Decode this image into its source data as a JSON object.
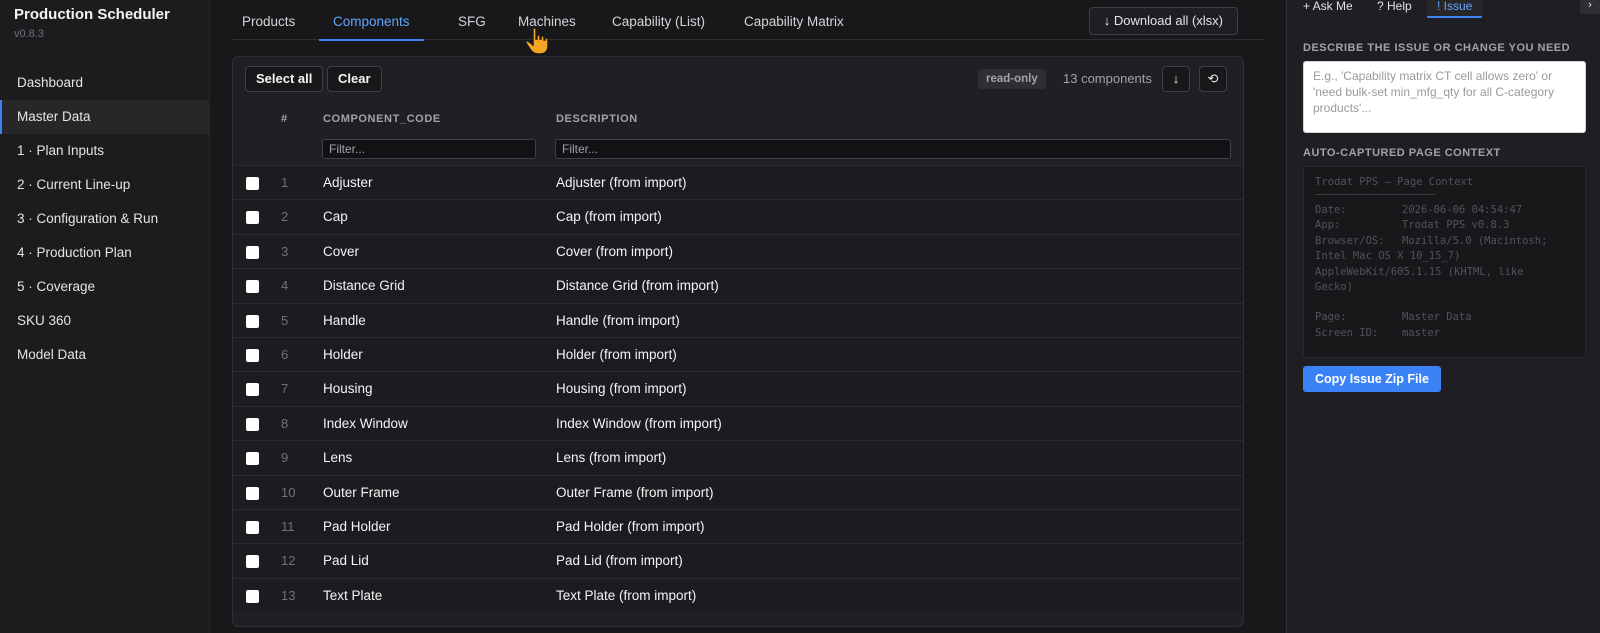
{
  "app": {
    "title": "Production Scheduler",
    "version": "v0.8.3"
  },
  "sidebar": {
    "items": [
      {
        "label": "Dashboard"
      },
      {
        "label": "Master Data"
      },
      {
        "label": "1 · Plan Inputs"
      },
      {
        "label": "2 · Current Line-up"
      },
      {
        "label": "3 · Configuration & Run"
      },
      {
        "label": "4 · Production Plan"
      },
      {
        "label": "5 · Coverage"
      },
      {
        "label": "SKU 360"
      },
      {
        "label": "Model Data"
      }
    ],
    "active_index": 1
  },
  "tabs": [
    {
      "label": "Products"
    },
    {
      "label": "Components"
    },
    {
      "label": "SFG"
    },
    {
      "label": "Machines"
    },
    {
      "label": "Capability (List)"
    },
    {
      "label": "Capability Matrix"
    }
  ],
  "active_tab": "Components",
  "download_label": "↓ Download all (xlsx)",
  "toolbar": {
    "select_all": "Select all",
    "clear": "Clear",
    "readonly": "read-only",
    "count": "13 components",
    "download_icon": "↓",
    "refresh_icon": "⟲"
  },
  "table": {
    "headers": {
      "num": "#",
      "code": "COMPONENT_CODE",
      "desc": "DESCRIPTION"
    },
    "filter_placeholder": "Filter...",
    "rows": [
      {
        "num": "1",
        "code": "Adjuster",
        "desc": "Adjuster (from import)"
      },
      {
        "num": "2",
        "code": "Cap",
        "desc": "Cap (from import)"
      },
      {
        "num": "3",
        "code": "Cover",
        "desc": "Cover (from import)"
      },
      {
        "num": "4",
        "code": "Distance Grid",
        "desc": "Distance Grid (from import)"
      },
      {
        "num": "5",
        "code": "Handle",
        "desc": "Handle (from import)"
      },
      {
        "num": "6",
        "code": "Holder",
        "desc": "Holder (from import)"
      },
      {
        "num": "7",
        "code": "Housing",
        "desc": "Housing (from import)"
      },
      {
        "num": "8",
        "code": "Index Window",
        "desc": "Index Window (from import)"
      },
      {
        "num": "9",
        "code": "Lens",
        "desc": "Lens (from import)"
      },
      {
        "num": "10",
        "code": "Outer Frame",
        "desc": "Outer Frame (from import)"
      },
      {
        "num": "11",
        "code": "Pad Holder",
        "desc": "Pad Holder (from import)"
      },
      {
        "num": "12",
        "code": "Pad Lid",
        "desc": "Pad Lid (from import)"
      },
      {
        "num": "13",
        "code": "Text Plate",
        "desc": "Text Plate (from import)"
      }
    ]
  },
  "right_panel": {
    "tabs": [
      {
        "label": "+ Ask Me"
      },
      {
        "label": "? Help"
      },
      {
        "label": "! Issue"
      }
    ],
    "active_tab": "! Issue",
    "collapse_icon": "›",
    "describe_label": "DESCRIBE THE ISSUE OR CHANGE YOU NEED",
    "describe_placeholder": "E.g., 'Capability matrix CT cell allows zero' or 'need bulk-set min_mfg_qty for all C-category products'...",
    "context_label": "AUTO-CAPTURED PAGE CONTEXT",
    "context": {
      "title": "Trodat PPS — Page Context",
      "lines": [
        {
          "key": "Date:",
          "value": "2026-06-06 04:54:47"
        },
        {
          "key": "App:",
          "value": "Trodat PPS v0.8.3"
        },
        {
          "key": "Browser/OS:",
          "value": "Mozilla/5.0 (Macintosh;"
        }
      ],
      "browser_cont_1": "Intel Mac OS X 10_15_7)",
      "browser_cont_2": "AppleWebKit/605.1.15 (KHTML, like",
      "browser_cont_3": "Gecko)",
      "page_key": "Page:",
      "page_value": "Master Data",
      "screen_key": "Screen ID:",
      "screen_value": "master"
    },
    "copy_button": "Copy Issue Zip File"
  },
  "colors": {
    "accent": "#3b82f6",
    "accent_text": "#60a5fa",
    "background": "#18181b"
  }
}
